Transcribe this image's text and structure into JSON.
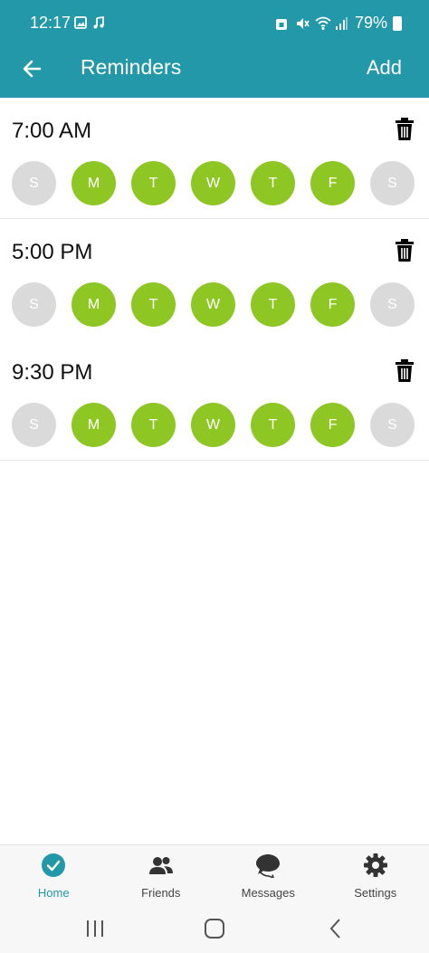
{
  "status_bar": {
    "time": "12:17",
    "battery": "79%"
  },
  "app_bar": {
    "title": "Reminders",
    "add_label": "Add"
  },
  "reminders": [
    {
      "time": "7:00 AM",
      "days": [
        {
          "label": "S",
          "active": false
        },
        {
          "label": "M",
          "active": true
        },
        {
          "label": "T",
          "active": true
        },
        {
          "label": "W",
          "active": true
        },
        {
          "label": "T",
          "active": true
        },
        {
          "label": "F",
          "active": true
        },
        {
          "label": "S",
          "active": false
        }
      ]
    },
    {
      "time": "5:00 PM",
      "days": [
        {
          "label": "S",
          "active": false
        },
        {
          "label": "M",
          "active": true
        },
        {
          "label": "T",
          "active": true
        },
        {
          "label": "W",
          "active": true
        },
        {
          "label": "T",
          "active": true
        },
        {
          "label": "F",
          "active": true
        },
        {
          "label": "S",
          "active": false
        }
      ]
    },
    {
      "time": "9:30 PM",
      "days": [
        {
          "label": "S",
          "active": false
        },
        {
          "label": "M",
          "active": true
        },
        {
          "label": "T",
          "active": true
        },
        {
          "label": "W",
          "active": true
        },
        {
          "label": "T",
          "active": true
        },
        {
          "label": "F",
          "active": true
        },
        {
          "label": "S",
          "active": false
        }
      ]
    }
  ],
  "bottom_nav": [
    {
      "label": "Home",
      "icon": "check-circle-icon",
      "active": true
    },
    {
      "label": "Friends",
      "icon": "people-icon",
      "active": false
    },
    {
      "label": "Messages",
      "icon": "chat-bubbles-icon",
      "active": false
    },
    {
      "label": "Settings",
      "icon": "gear-icon",
      "active": false
    }
  ],
  "colors": {
    "primary": "#2298a9",
    "day_active": "#8ec724",
    "day_inactive": "#dadada"
  }
}
